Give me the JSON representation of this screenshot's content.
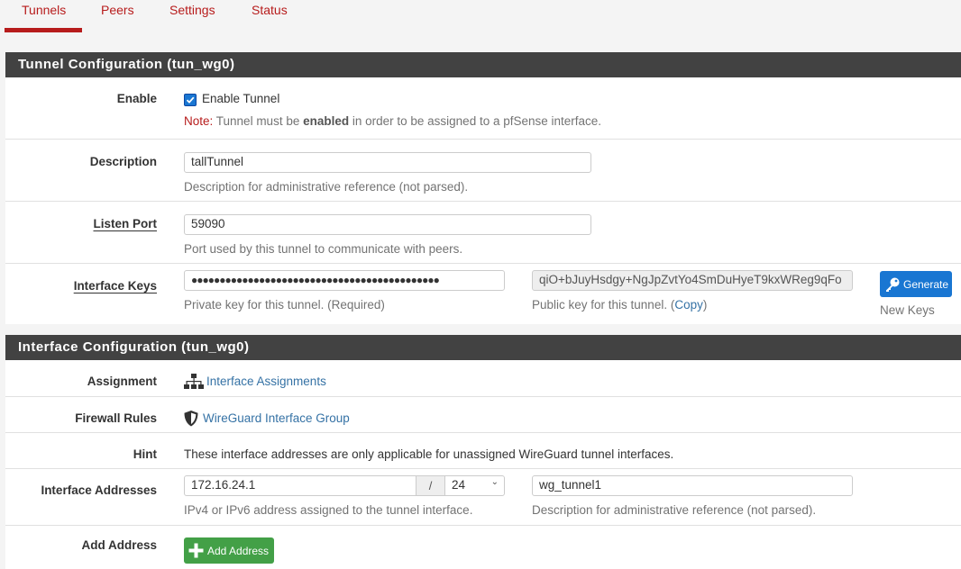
{
  "tabs": [
    {
      "label": "Tunnels",
      "active": true
    },
    {
      "label": "Peers",
      "active": false
    },
    {
      "label": "Settings",
      "active": false
    },
    {
      "label": "Status",
      "active": false
    }
  ],
  "tunnel_config": {
    "heading": "Tunnel Configuration (tun_wg0)",
    "enable": {
      "label": "Enable",
      "checkbox_label": "Enable Tunnel",
      "checked": true,
      "note_prefix": "Note:",
      "note_text_1": " Tunnel must be ",
      "note_bold": "enabled",
      "note_text_2": " in order to be assigned to a pfSense interface."
    },
    "description": {
      "label": "Description",
      "value": "tallTunnel",
      "help": "Description for administrative reference (not parsed)."
    },
    "listen_port": {
      "label": "Listen Port",
      "value": "59090",
      "help": "Port used by this tunnel to communicate with peers."
    },
    "interface_keys": {
      "label": "Interface Keys",
      "private_key_masked": "●●●●●●●●●●●●●●●●●●●●●●●●●●●●●●●●●●●●●●●●●●●●",
      "private_help": "Private key for this tunnel. (Required)",
      "public_key": "qiO+bJuyHsdgy+NgJpZvtYo4SmDuHyeT9kxWReg9qFo",
      "public_help_prefix": "Public key for this tunnel. (",
      "copy_link": "Copy",
      "public_help_suffix": ")",
      "generate_button": "Generate",
      "generate_help": "New Keys"
    }
  },
  "interface_config": {
    "heading": "Interface Configuration (tun_wg0)",
    "assignment": {
      "label": "Assignment",
      "link": "Interface Assignments"
    },
    "firewall_rules": {
      "label": "Firewall Rules",
      "link": "WireGuard Interface Group"
    },
    "hint": {
      "label": "Hint",
      "text": "These interface addresses are only applicable for unassigned WireGuard tunnel interfaces."
    },
    "interface_addresses": {
      "label": "Interface Addresses",
      "address": "172.16.24.1",
      "separator": "/",
      "cidr": "24",
      "address_help": "IPv4 or IPv6 address assigned to the tunnel interface.",
      "description": "wg_tunnel1",
      "description_help": "Description for administrative reference (not parsed)."
    },
    "add_address": {
      "label": "Add Address",
      "button": "Add Address"
    }
  },
  "colors": {
    "accent_red": "#b71c1c",
    "heading_bg": "#424242",
    "primary_blue": "#1976d2",
    "success_green": "#43a047",
    "link_blue": "#3572a5"
  }
}
